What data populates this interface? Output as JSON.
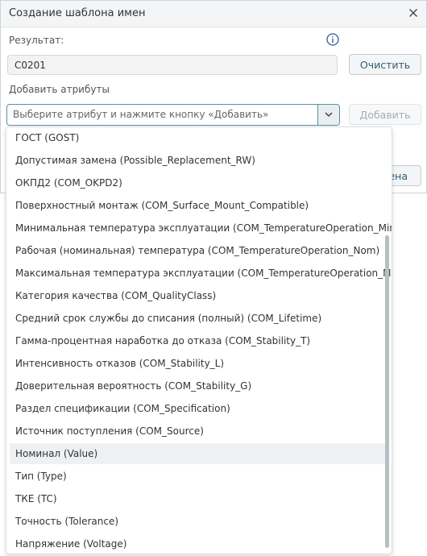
{
  "dialog": {
    "title": "Создание шаблона имен",
    "result_label": "Результат:",
    "result_value": "C0201",
    "clear_label": "Очистить",
    "add_attrs_label": "Добавить атрибуты",
    "select_placeholder": "Выберите атрибут и нажмите кнопку «Добавить»",
    "add_label": "Добавить",
    "hidden_button_fragment": "ена"
  },
  "dropdown": {
    "options": [
      "ГОСТ (GOST)",
      "Допустимая замена (Possible_Replacement_RW)",
      "ОКПД2 (COM_OKPD2)",
      "Поверхностный монтаж (COM_Surface_Mount_Compatible)",
      "Минимальная температура эксплуатации (COM_TemperatureOperation_Min)",
      "Рабочая (номинальная) температура (COM_TemperatureOperation_Nom)",
      "Максимальная температура эксплуатации (COM_TemperatureOperation_Max)",
      "Категория качества (COM_QualityClass)",
      "Средний срок службы до списания (полный) (COM_Lifetime)",
      "Гамма-процентная наработка до отказа (COM_Stability_T)",
      "Интенсивность отказов (COM_Stability_L)",
      "Доверительная вероятность (COM_Stability_G)",
      "Раздел спецификации (COM_Specification)",
      "Источник поступления (COM_Source)",
      "Номинал (Value)",
      "Тип (Type)",
      "ТКЕ (TC)",
      "Точность (Tolerance)",
      "Напряжение (Voltage)"
    ],
    "highlighted_index": 14
  },
  "colors": {
    "accent": "#2f5d73",
    "focus_border": "#5b8fa3"
  }
}
